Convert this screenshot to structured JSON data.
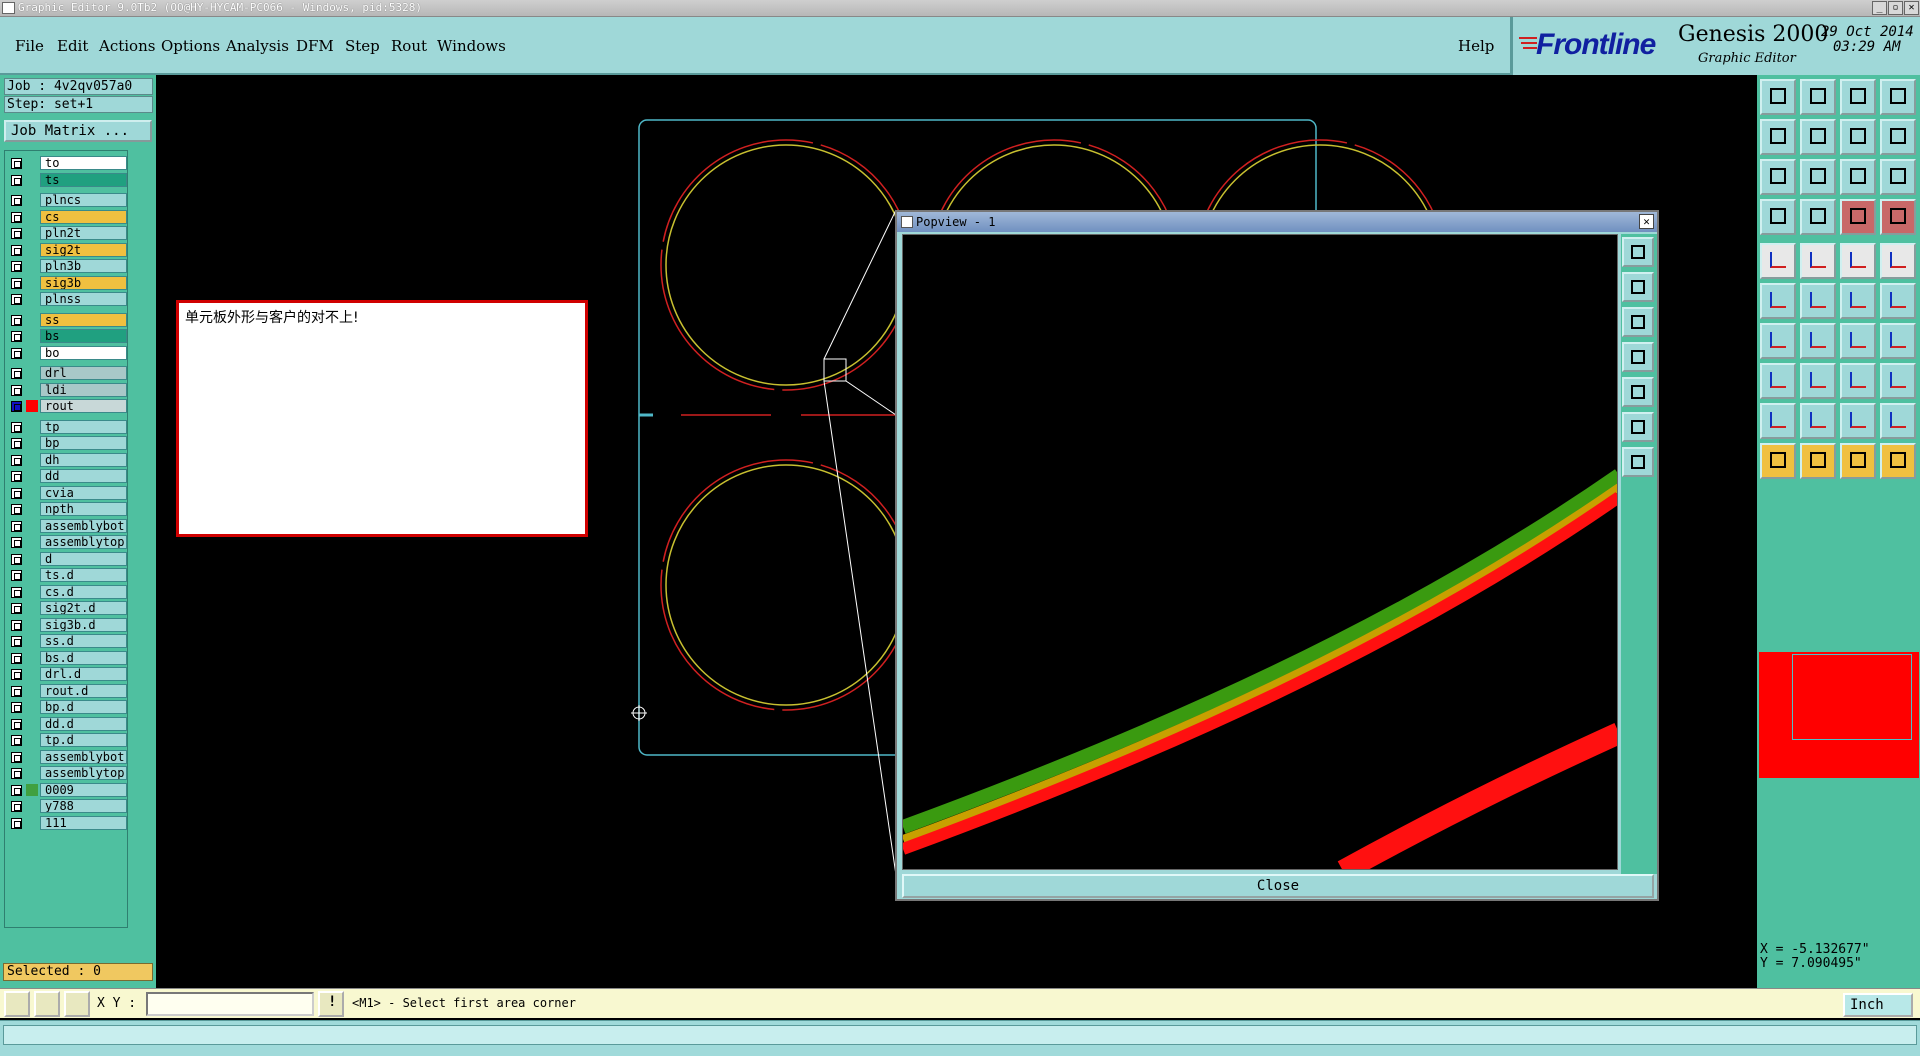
{
  "window": {
    "title": "Graphic Editor 9.0Tb2 (OO@HY-HYCAM-PC066 - Windows, pid:5328)"
  },
  "menu": {
    "items": [
      "File",
      "Edit",
      "Actions",
      "Options",
      "Analysis",
      "DFM",
      "Step",
      "Rout",
      "Windows"
    ],
    "help": "Help"
  },
  "brand": {
    "logo": "Frontline",
    "product": "Genesis 2000",
    "subtitle": "Graphic Editor",
    "date": "29 Oct 2014",
    "time": "03:29 AM"
  },
  "job": {
    "job_label": "Job : 4v2qv057a0",
    "step_label": "Step: set+1",
    "matrix_button": "Job Matrix ..."
  },
  "layers": [
    {
      "name": "to",
      "color": "#ffffff",
      "group": 0
    },
    {
      "name": "ts",
      "color": "#20a080",
      "group": 0
    },
    {
      "name": "plncs",
      "color": "#9fd8d8",
      "group": 1
    },
    {
      "name": "cs",
      "color": "#f0c040",
      "group": 1
    },
    {
      "name": "pln2t",
      "color": "#9fd8d8",
      "group": 1
    },
    {
      "name": "sig2t",
      "color": "#f0c040",
      "group": 1
    },
    {
      "name": "pln3b",
      "color": "#9fd8d8",
      "group": 1
    },
    {
      "name": "sig3b",
      "color": "#f0c040",
      "group": 1
    },
    {
      "name": "plnss",
      "color": "#9fd8d8",
      "group": 1
    },
    {
      "name": "ss",
      "color": "#f0c040",
      "group": 2
    },
    {
      "name": "bs",
      "color": "#20a080",
      "group": 2
    },
    {
      "name": "bo",
      "color": "#ffffff",
      "group": 2
    },
    {
      "name": "drl",
      "color": "#a8c8c8",
      "group": 3
    },
    {
      "name": "ldi",
      "color": "#a8c8c8",
      "group": 3
    },
    {
      "name": "rout",
      "color": "#c8d8d8",
      "group": 3,
      "active": true
    },
    {
      "name": "tp",
      "color": "#9fd8d8",
      "group": 4
    },
    {
      "name": "bp",
      "color": "#9fd8d8",
      "group": 4
    },
    {
      "name": "dh",
      "color": "#9fd8d8",
      "group": 4
    },
    {
      "name": "dd",
      "color": "#9fd8d8",
      "group": 4
    },
    {
      "name": "cvia",
      "color": "#9fd8d8",
      "group": 4
    },
    {
      "name": "npth",
      "color": "#9fd8d8",
      "group": 4
    },
    {
      "name": "assemblybot",
      "color": "#9fd8d8",
      "group": 4
    },
    {
      "name": "assemblytop",
      "color": "#9fd8d8",
      "group": 4
    },
    {
      "name": "d",
      "color": "#9fd8d8",
      "group": 4
    },
    {
      "name": "ts.d",
      "color": "#9fd8d8",
      "group": 4
    },
    {
      "name": "cs.d",
      "color": "#9fd8d8",
      "group": 4
    },
    {
      "name": "sig2t.d",
      "color": "#9fd8d8",
      "group": 4
    },
    {
      "name": "sig3b.d",
      "color": "#9fd8d8",
      "group": 4
    },
    {
      "name": "ss.d",
      "color": "#9fd8d8",
      "group": 4
    },
    {
      "name": "bs.d",
      "color": "#9fd8d8",
      "group": 4
    },
    {
      "name": "drl.d",
      "color": "#9fd8d8",
      "group": 4
    },
    {
      "name": "rout.d",
      "color": "#9fd8d8",
      "group": 4
    },
    {
      "name": "bp.d",
      "color": "#9fd8d8",
      "group": 4
    },
    {
      "name": "dd.d",
      "color": "#9fd8d8",
      "group": 4
    },
    {
      "name": "tp.d",
      "color": "#9fd8d8",
      "group": 4
    },
    {
      "name": "assemblybot",
      "color": "#9fd8d8",
      "group": 4
    },
    {
      "name": "assemblytop",
      "color": "#9fd8d8",
      "group": 4
    },
    {
      "name": "0009",
      "color": "#9fd8d8",
      "group": 4,
      "swatch": "#40a040"
    },
    {
      "name": "y788",
      "color": "#9fd8d8",
      "group": 4
    },
    {
      "name": "111",
      "color": "#9fd8d8",
      "group": 4
    }
  ],
  "selected": "Selected : 0",
  "message": "单元板外形与客户的对不上!",
  "popview": {
    "title": "Popview - 1",
    "close": "Close"
  },
  "coords": {
    "x": "X = -5.132677\"",
    "y": "Y = 7.090495\""
  },
  "status": {
    "xy_label": "X Y :",
    "xy_value": "",
    "prompt": "<M1> - Select first area corner",
    "unit": "Inch"
  }
}
